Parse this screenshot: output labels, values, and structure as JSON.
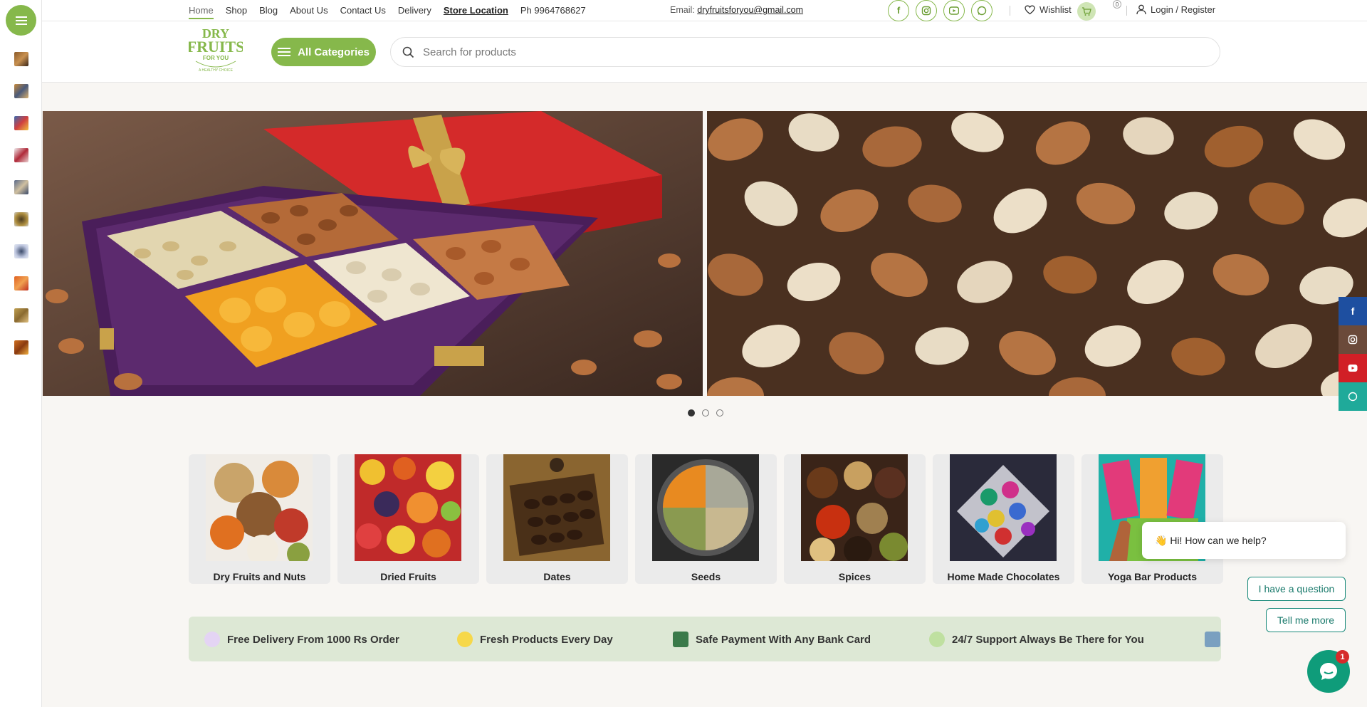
{
  "topnav": {
    "items": [
      "Home",
      "Shop",
      "Blog",
      "About Us",
      "Contact Us",
      "Delivery",
      "Store Location"
    ],
    "phone": "Ph  9964768627",
    "email_label": "Email: ",
    "email": "dryfruitsforyou@gmail.com"
  },
  "socials": [
    "facebook-icon",
    "instagram-icon",
    "youtube-icon",
    "whatsapp-icon"
  ],
  "header_actions": {
    "wishlist": "Wishlist",
    "cart_count": "0",
    "login": "Login / Register"
  },
  "logo": {
    "line1": "DRY",
    "line2": "FRUITS",
    "line3": "FOR YOU",
    "tagline": "A HEALTHY CHOICE"
  },
  "header": {
    "all_categories": "All Categories",
    "search_placeholder": "Search for products"
  },
  "slider": {
    "dots": 3,
    "active_dot": 0
  },
  "categories": [
    {
      "label": "Dry Fruits and Nuts"
    },
    {
      "label": "Dried Fruits"
    },
    {
      "label": "Dates"
    },
    {
      "label": "Seeds"
    },
    {
      "label": "Spices"
    },
    {
      "label": "Home Made Chocolates"
    },
    {
      "label": "Yoga Bar Products"
    }
  ],
  "features": [
    {
      "label": "Free Delivery From 1000 Rs Order"
    },
    {
      "label": "Fresh Products Every Day"
    },
    {
      "label": "Safe Payment With Any Bank Card"
    },
    {
      "label": "24/7 Support Always Be There for You"
    }
  ],
  "chat": {
    "greeting": "👋 Hi! How can we help?",
    "option1": "I have a question",
    "option2": "Tell me more",
    "badge": "1"
  },
  "colors": {
    "accent": "#86b84b",
    "facebook": "#1e4fa0",
    "instagram": "#6b4a3a",
    "youtube": "#d11f26",
    "whatsapp": "#1faa9a",
    "chat": "#0f9c7a"
  }
}
